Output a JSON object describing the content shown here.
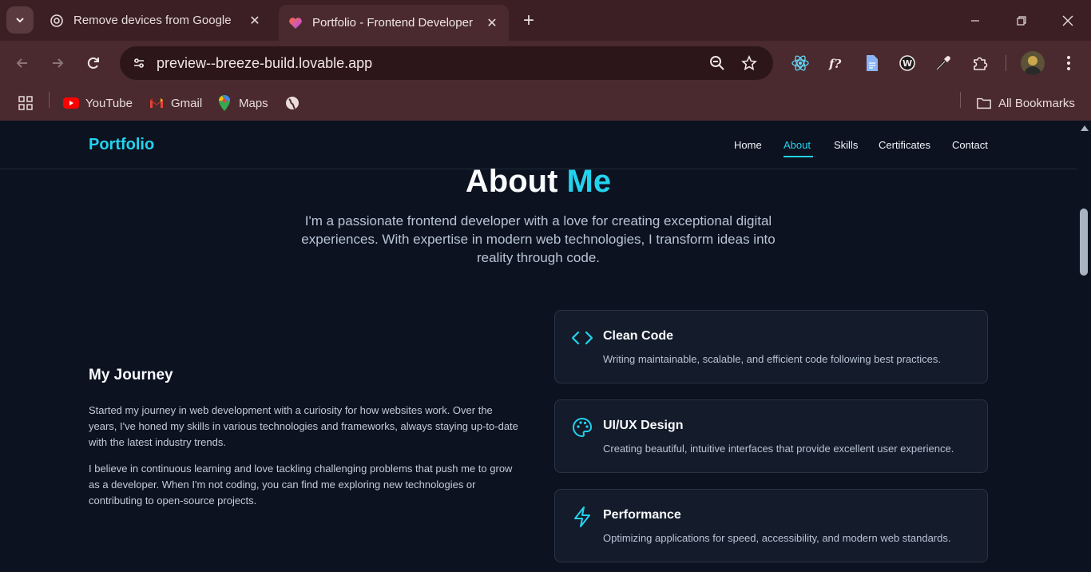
{
  "browser": {
    "tabs": [
      {
        "title": "Remove devices from Google",
        "active": false
      },
      {
        "title": "Portfolio - Frontend Developer",
        "active": true
      }
    ],
    "url": "preview--breeze-build.lovable.app",
    "bookmarks": [
      {
        "label": "YouTube",
        "icon": "youtube-icon"
      },
      {
        "label": "Gmail",
        "icon": "gmail-icon"
      },
      {
        "label": "Maps",
        "icon": "maps-icon"
      }
    ],
    "all_bookmarks_label": "All Bookmarks",
    "colors": {
      "tabstrip": "#3b1f24",
      "toolbar": "#4a2a2f",
      "omnibox": "#2c1619"
    }
  },
  "site": {
    "logo": "Portfolio",
    "nav": [
      "Home",
      "About",
      "Skills",
      "Certificates",
      "Contact"
    ],
    "active_nav": "About",
    "accent": "#22d3ee",
    "background": "#0c1220"
  },
  "about": {
    "title_part1": "About",
    "title_part2": "Me",
    "intro": "I'm a passionate frontend developer with a love for creating exceptional digital experiences. With expertise in modern web technologies, I transform ideas into reality through code.",
    "journey_title": "My Journey",
    "paragraphs": [
      "Started my journey in web development with a curiosity for how websites work. Over the years, I've honed my skills in various technologies and frameworks, always staying up-to-date with the latest industry trends.",
      "I believe in continuous learning and love tackling challenging problems that push me to grow as a developer. When I'm not coding, you can find me exploring new technologies or contributing to open-source projects."
    ],
    "cards": [
      {
        "title": "Clean Code",
        "desc": "Writing maintainable, scalable, and efficient code following best practices.",
        "icon": "code-icon"
      },
      {
        "title": "UI/UX Design",
        "desc": "Creating beautiful, intuitive interfaces that provide excellent user experience.",
        "icon": "palette-icon"
      },
      {
        "title": "Performance",
        "desc": "Optimizing applications for speed, accessibility, and modern web standards.",
        "icon": "lightning-icon"
      }
    ]
  }
}
